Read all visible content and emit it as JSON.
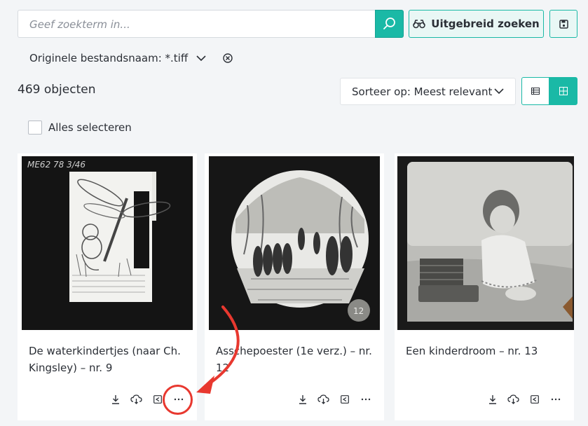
{
  "search": {
    "placeholder": "Geef zoekterm in..."
  },
  "advanced_search": {
    "label": "Uitgebreid zoeken"
  },
  "filter": {
    "label": "Originele bestandsnaam: *.tiff"
  },
  "results": {
    "count": "469 objecten"
  },
  "sort": {
    "label": "Sorteer op: Meest relevant"
  },
  "select_all": {
    "label": "Alles selecteren"
  },
  "cards": [
    {
      "title": "De waterkindertjes (naar Ch. Kingsley) – nr. 9",
      "plate_label": "ME62   78   3/46"
    },
    {
      "title": "Asschepoester (1e verz.) – nr. 12",
      "plate_label": "12"
    },
    {
      "title": "Een kinderdroom – nr. 13",
      "plate_label": ""
    }
  ],
  "colors": {
    "accent": "#1ab9a6",
    "annotation": "#e8382f",
    "background": "#f3f5f7"
  },
  "icons": [
    "search-icon",
    "binoculars-icon",
    "save-icon",
    "chevron-down-icon",
    "close-circle-icon",
    "list-view-icon",
    "grid-view-icon",
    "download-icon",
    "cloud-download-icon",
    "share-icon",
    "more-icon"
  ]
}
